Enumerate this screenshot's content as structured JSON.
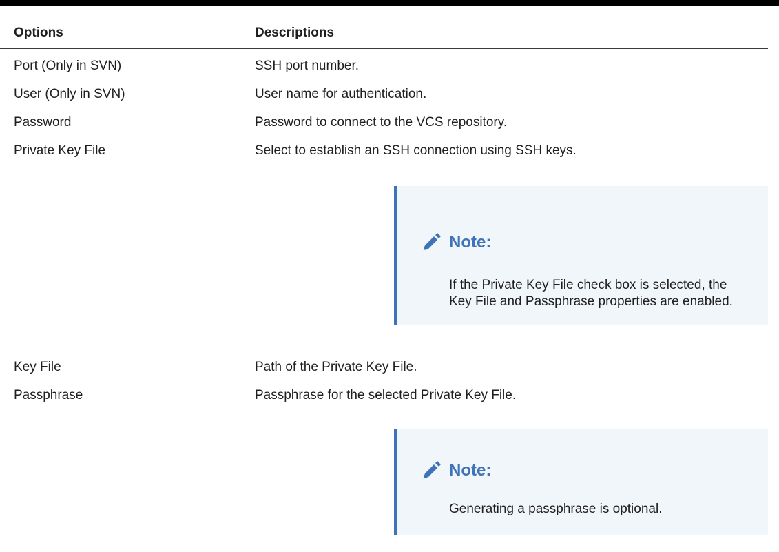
{
  "table": {
    "headers": {
      "options": "Options",
      "descriptions": "Descriptions"
    },
    "rows": [
      {
        "option": "Port (Only in SVN)",
        "description": "SSH port number."
      },
      {
        "option": "User (Only in SVN)",
        "description": "User name for authentication."
      },
      {
        "option": "Password",
        "description": "Password to connect to the VCS repository."
      },
      {
        "option": "Private Key File",
        "description": "Select to establish an SSH connection using SSH keys."
      },
      {
        "option": "Key File",
        "description": "Path of the Private Key File."
      },
      {
        "option": "Passphrase",
        "description": "Passphrase for the selected Private Key File."
      }
    ]
  },
  "notes": [
    {
      "title": "Note:",
      "icon": "pencil-icon",
      "body": "If the Private Key File check box is selected, the Key File and Passphrase properties are enabled."
    },
    {
      "title": "Note:",
      "icon": "pencil-icon",
      "body": "Generating a passphrase is optional."
    }
  ],
  "colors": {
    "accent": "#3f73b8",
    "note_background": "#f1f6fb",
    "text": "#1f1f1f"
  }
}
